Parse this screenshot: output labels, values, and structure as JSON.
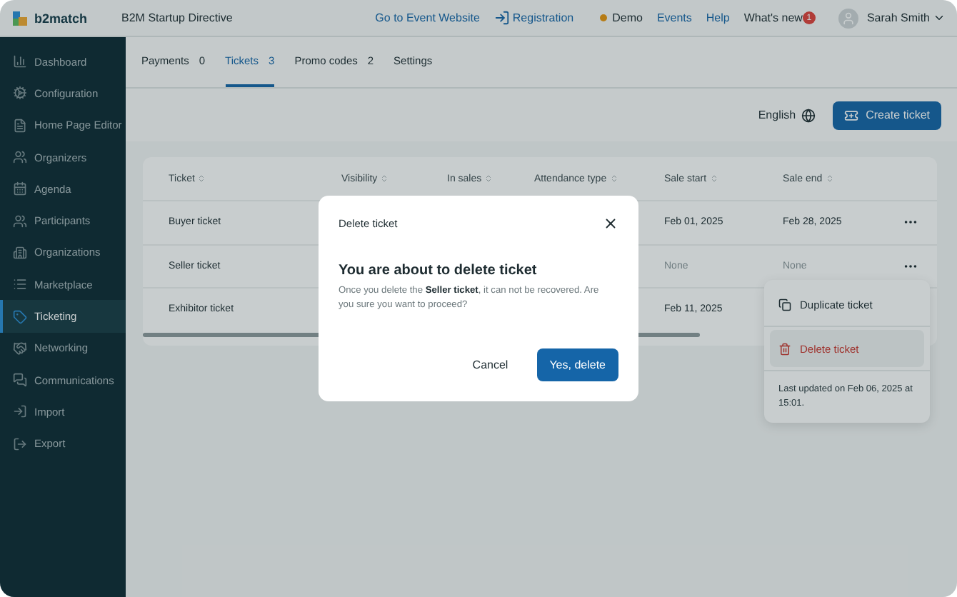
{
  "topbar": {
    "brand": "b2match",
    "event": "B2M Startup Directive",
    "links": [
      {
        "label": "Go to Event Website",
        "kind": "link"
      },
      {
        "label": "Registration",
        "kind": "icon-link"
      }
    ],
    "demo": {
      "label": "Demo"
    },
    "menu": [
      "Events",
      "Help"
    ],
    "whats_new": {
      "label": "What's new",
      "badge": "1"
    },
    "user": "Sarah Smith"
  },
  "sidebar": {
    "items": [
      {
        "label": "Dashboard",
        "selected": false
      },
      {
        "label": "Configuration",
        "selected": false
      },
      {
        "label": "Home Page Editor",
        "selected": false
      },
      {
        "label": "Organizers",
        "selected": false
      },
      {
        "label": "Agenda",
        "selected": false
      },
      {
        "label": "Participants",
        "selected": false
      },
      {
        "label": "Organizations",
        "selected": false
      },
      {
        "label": "Marketplace",
        "selected": false
      },
      {
        "label": "Ticketing",
        "selected": true
      },
      {
        "label": "Networking",
        "selected": false
      },
      {
        "label": "Communications",
        "selected": false
      },
      {
        "label": "Import",
        "selected": false
      },
      {
        "label": "Export",
        "selected": false
      }
    ]
  },
  "tabs": [
    {
      "label": "Payments",
      "count": "0",
      "selected": false
    },
    {
      "label": "Tickets",
      "count": "3",
      "selected": true
    },
    {
      "label": "Promo codes",
      "count": "2",
      "selected": false
    },
    {
      "label": "Settings",
      "selected": false
    }
  ],
  "toolbar": {
    "language": "English",
    "create": "Create ticket"
  },
  "table": {
    "columns": [
      "Ticket",
      "Visibility",
      "In sales",
      "Attendance type",
      "Sale start",
      "Sale end"
    ],
    "rows": [
      {
        "ticket": "Buyer ticket",
        "sale_start": "Feb 01, 2025",
        "sale_end": "Feb 28, 2025",
        "muted": false,
        "actions": true
      },
      {
        "ticket": "Seller ticket",
        "sale_start": "None",
        "sale_end": "None",
        "muted": true,
        "actions": true
      },
      {
        "ticket": "Exhibitor ticket",
        "sale_start": "Feb 11, 2025",
        "muted": false
      }
    ]
  },
  "row_menu": {
    "items": [
      {
        "label": "Duplicate ticket",
        "kind": "duplicate",
        "selected": false
      },
      {
        "label": "Delete ticket",
        "kind": "delete",
        "selected": true
      }
    ],
    "note": "Last updated on Feb 06, 2025 at 15:01."
  },
  "dialog": {
    "title": "Delete ticket",
    "heading": "You are about to delete ticket",
    "body": "Once you delete the **Seller ticket**, it can not be recovered. Are you sure you want to proceed?",
    "cancel": "Cancel",
    "confirm": "Yes, delete"
  }
}
